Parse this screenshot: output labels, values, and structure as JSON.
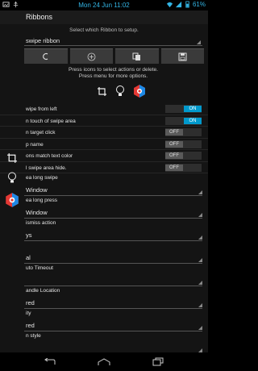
{
  "status_bar": {
    "clock": "Mon 24 Jun 11:02",
    "battery": "61"
  },
  "action_bar": {
    "title": "Ribbons"
  },
  "header": {
    "subtitle": "Select which Ribbon to setup.",
    "ribbon_selector": "swipe ribbon"
  },
  "toolbar": {
    "buttons": [
      "back",
      "add",
      "copy",
      "save"
    ]
  },
  "hint": {
    "line1": "Press icons to select actions or delete.",
    "line2": "Press menu for more options."
  },
  "ribbon_icons": [
    "crop-icon",
    "lightbulb-icon",
    "app-logo-icon"
  ],
  "toggles": [
    {
      "label": "wipe from left",
      "state": "ON"
    },
    {
      "label": "n touch of swipe area",
      "state": "ON"
    },
    {
      "label": "n target click",
      "state": "OFF"
    },
    {
      "label": "p name",
      "state": "OFF"
    },
    {
      "label": "ons match text color",
      "state": "OFF"
    },
    {
      "label": "l swipe area hide.",
      "state": "OFF"
    }
  ],
  "prefs": [
    {
      "label": "ea long swipe",
      "value": "Window"
    },
    {
      "label": "ea long press",
      "value": "Window"
    },
    {
      "label": "ismiss action",
      "value": "ys"
    },
    {
      "label": "",
      "value": "al"
    },
    {
      "label": "uto Timeout",
      "value": ""
    },
    {
      "label": "andle Location",
      "value": "red"
    },
    {
      "label": "ity",
      "value": "red"
    },
    {
      "label": "n style",
      "value": ""
    }
  ],
  "colors": {
    "accent": "#33b5e5",
    "toggle_on": "#0099cc",
    "app_logo_red": "#e53935",
    "app_logo_blue": "#1e88e5"
  }
}
